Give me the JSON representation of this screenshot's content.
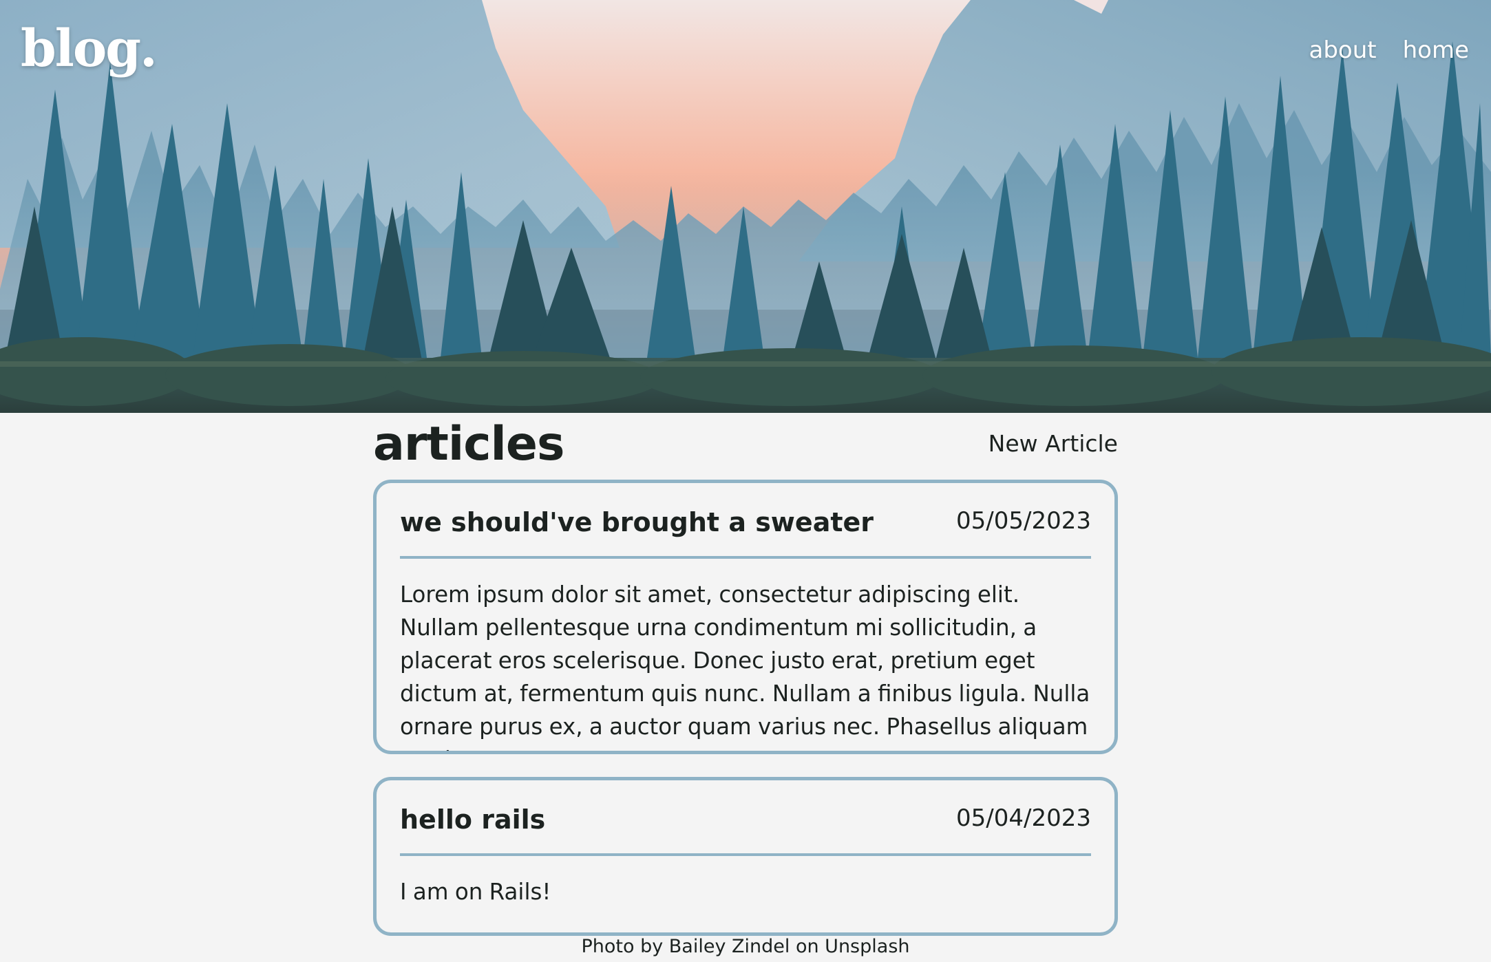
{
  "header": {
    "logo": "blog.",
    "nav": [
      {
        "label": "about"
      },
      {
        "label": "home"
      }
    ]
  },
  "main": {
    "title": "articles",
    "new_article_label": "New Article",
    "articles": [
      {
        "title": "we should've brought a sweater",
        "date": "05/05/2023",
        "body": "Lorem ipsum dolor sit amet, consectetur adipiscing elit. Nullam pellentesque urna condimentum mi sollicitudin, a placerat eros scelerisque. Donec justo erat, pretium eget dictum at, fermentum quis nunc. Nullam a finibus ligula. Nulla ornare purus ex, a auctor quam varius nec. Phasellus aliquam ex sit"
      },
      {
        "title": "hello rails",
        "date": "05/04/2023",
        "body": "I am on Rails!"
      }
    ]
  },
  "footer": {
    "credit": "Photo by Bailey Zindel on Unsplash"
  },
  "colors": {
    "page_bg": "#f4f4f4",
    "card_border": "#8fb3c6",
    "text": "#1c2220",
    "hero_sky_glow": "#f6a385",
    "hero_trees": "#2c6478"
  }
}
